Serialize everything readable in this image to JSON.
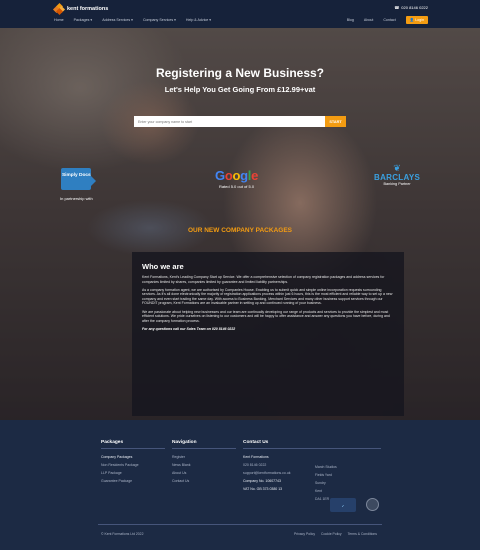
{
  "header": {
    "logo_text": "kent formations",
    "phone": "020 8146 0222",
    "nav": [
      "Home",
      "Packages ▾",
      "Address Services ▾",
      "Company Services ▾",
      "Help & Advice ▾"
    ],
    "nav_right": [
      "Blog",
      "About",
      "Contact"
    ],
    "login_label": "Login"
  },
  "hero": {
    "title": "Registering a New Business?",
    "subtitle": "Let's Help You Get Going From £12.99+vat",
    "search_placeholder": "Enter your company name to start",
    "search_button": "START",
    "partner_badge": "Simply Docs",
    "partner_caption": "In partnership with",
    "google_letters": [
      "G",
      "o",
      "o",
      "g",
      "l",
      "e"
    ],
    "google_rating": "Rated 5.0 out of 5.0",
    "bank_name": "BARCLAYS",
    "bank_caption": "Banking Partner",
    "new_packages": "OUR NEW COMPANY PACKAGES"
  },
  "who": {
    "heading": "Who we are",
    "p1": "Kent Formations, Kent's Leading Company Start up Service. We offer a comprehensive selection of company registration packages and address services for companies limited by shares, companies limited by guarantee and limited liability partnerships.",
    "p2": "As a company formation agent, we are authorised by Companies House. Enabling us to submit quick and simple online incorporation requests surrounding services. As it's all done electronically the majority of registration applications process within just 6 hours, this is the most efficient and reliable way to set up a new company and even start trading the same day. With access to Business Banking, Merchant Services and many other business support services through our FOUNDIT program, Kent Formations are an invaluable partner in setting up and continued running of your business.",
    "p3": "We are passionate about helping new businesses and our team are continually developing our range of products and services to provide the simplest and most efficient solutions. We pride ourselves on listening to our customers and will be happy to offer assistance and answer any questions you have before, during and after the company formation process.",
    "cta": "For any questions call our Sales Team on  020 8146 0222"
  },
  "footer": {
    "packages_title": "Packages",
    "packages": [
      "Company Packages",
      "Non Residents Package",
      "LLP Package",
      "Guarantee Package"
    ],
    "navigation_title": "Navigation",
    "navigation": [
      "Register",
      "News Blank",
      "About Us",
      "Contact Us"
    ],
    "contact_title": "Contact Us",
    "contact": [
      "Kent Formations",
      "020 8146 0222",
      "support@kentformations.co.uk",
      "Company No. 10607743",
      "VAT No. GB 373 0380 13"
    ],
    "address": [
      "March Studios",
      "Fields Yard",
      "Sundry",
      "Kent",
      "DA1 1ER"
    ],
    "copyright": "© Kent Formations Ltd 2022",
    "legal": [
      "Privacy Policy",
      "Cookie Policy",
      "Terms & Conditions"
    ]
  }
}
